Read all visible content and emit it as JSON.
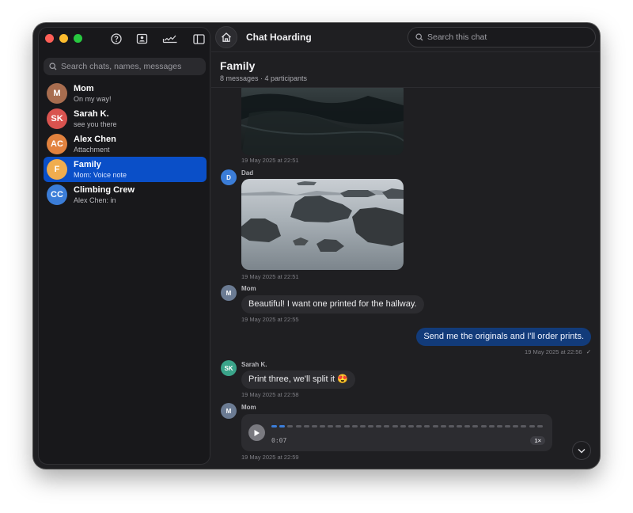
{
  "app": {
    "title": "Chat Hoarding"
  },
  "colors": {
    "accent": "#0a4fc8",
    "outgoing_bubble": "#123b7a",
    "incoming_bubble": "#2c2c30",
    "traffic_close": "#ff5f57",
    "traffic_min": "#febc2e",
    "traffic_max": "#28c840"
  },
  "toolbar_icons": [
    "help-icon",
    "contacts-icon",
    "signature-icon",
    "sidebar-toggle-icon"
  ],
  "sidebar": {
    "search_placeholder": "Search chats, names, messages",
    "chats": [
      {
        "initials": "M",
        "name": "Mom",
        "preview": "On my way!",
        "color": "#a86d4f",
        "active": false
      },
      {
        "initials": "SK",
        "name": "Sarah K.",
        "preview": "see you there",
        "color": "#d9534f",
        "active": false
      },
      {
        "initials": "AC",
        "name": "Alex Chen",
        "preview": "Attachment",
        "color": "#e2823e",
        "active": false
      },
      {
        "initials": "F",
        "name": "Family",
        "preview": "Mom: Voice note",
        "color": "#f0ad4e",
        "active": true
      },
      {
        "initials": "CC",
        "name": "Climbing Crew",
        "preview": "Alex Chen: in",
        "color": "#3b7dd8",
        "active": false
      }
    ]
  },
  "chat_search_placeholder": "Search this chat",
  "conversation": {
    "title": "Family",
    "subtitle": "8 messages · 4 participants",
    "messages": [
      {
        "type": "image",
        "time": "19 May 2025 at 22:51"
      },
      {
        "type": "image",
        "sender": "Dad",
        "initial": "D",
        "avatar_color": "#3b7dd8",
        "time": "19 May 2025 at 22:51"
      },
      {
        "type": "text",
        "sender": "Mom",
        "initial": "M",
        "avatar_color": "#6b7b93",
        "text": "Beautiful! I want one printed for the hallway.",
        "time": "19 May 2025 at 22:55"
      },
      {
        "type": "text",
        "outgoing": true,
        "text": "Send me the originals and I'll order prints.",
        "time": "19 May 2025 at 22:56",
        "status": "✓"
      },
      {
        "type": "text",
        "sender": "Sarah K.",
        "initial": "SK",
        "avatar_color": "#3aa48a",
        "text": "Print three, we'll split it 😍",
        "time": "19 May 2025 at 22:58"
      },
      {
        "type": "voice",
        "sender": "Mom",
        "initial": "M",
        "avatar_color": "#6b7b93",
        "duration": "0:07",
        "speed": "1×",
        "progress": 0.03,
        "time": "19 May 2025 at 22:59"
      }
    ]
  }
}
